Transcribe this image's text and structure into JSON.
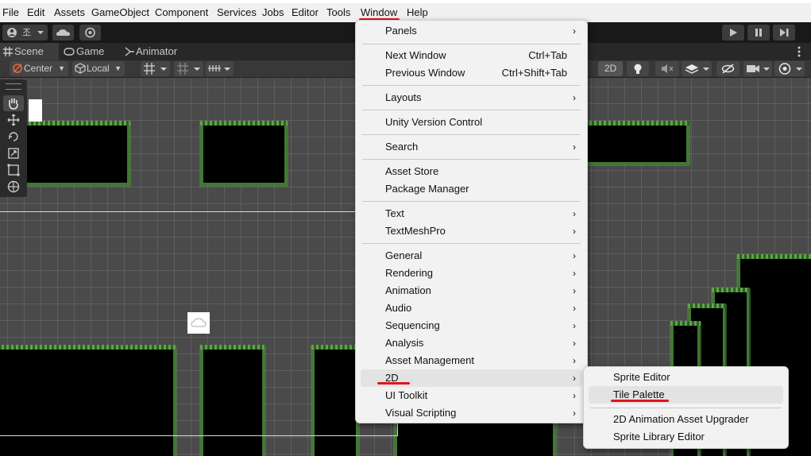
{
  "menubar": {
    "items": [
      "File",
      "Edit",
      "Assets",
      "GameObject",
      "Component",
      "Services",
      "Jobs",
      "Editor",
      "Tools",
      "Window",
      "Help"
    ]
  },
  "toolbar": {
    "account_label": "조"
  },
  "tabs": {
    "scene": "Scene",
    "game": "Game",
    "animator": "Animator"
  },
  "scenebar": {
    "pivot_label": "Center",
    "space_label": "Local",
    "mode_2d": "2D"
  },
  "window_menu": {
    "items": [
      {
        "label": "Panels",
        "submenu": true
      },
      {
        "label": "Next Window",
        "shortcut": "Ctrl+Tab"
      },
      {
        "label": "Previous Window",
        "shortcut": "Ctrl+Shift+Tab"
      },
      {
        "label": "Layouts",
        "submenu": true
      },
      {
        "label": "Unity Version Control"
      },
      {
        "label": "Search",
        "submenu": true
      },
      {
        "label": "Asset Store"
      },
      {
        "label": "Package Manager"
      },
      {
        "label": "Text",
        "submenu": true
      },
      {
        "label": "TextMeshPro",
        "submenu": true
      },
      {
        "label": "General",
        "submenu": true
      },
      {
        "label": "Rendering",
        "submenu": true
      },
      {
        "label": "Animation",
        "submenu": true
      },
      {
        "label": "Audio",
        "submenu": true
      },
      {
        "label": "Sequencing",
        "submenu": true
      },
      {
        "label": "Analysis",
        "submenu": true
      },
      {
        "label": "Asset Management",
        "submenu": true
      },
      {
        "label": "2D",
        "submenu": true
      },
      {
        "label": "UI Toolkit",
        "submenu": true
      },
      {
        "label": "Visual Scripting",
        "submenu": true
      }
    ],
    "arrow": "›"
  },
  "submenu_2d": {
    "items": [
      "Sprite Editor",
      "Tile Palette",
      "2D Animation Asset Upgrader",
      "Sprite Library Editor"
    ]
  },
  "colors": {
    "annotation_red": "#e0141e",
    "menu_bg": "#f2f2f2",
    "scene_bg": "#4a4a4a"
  }
}
